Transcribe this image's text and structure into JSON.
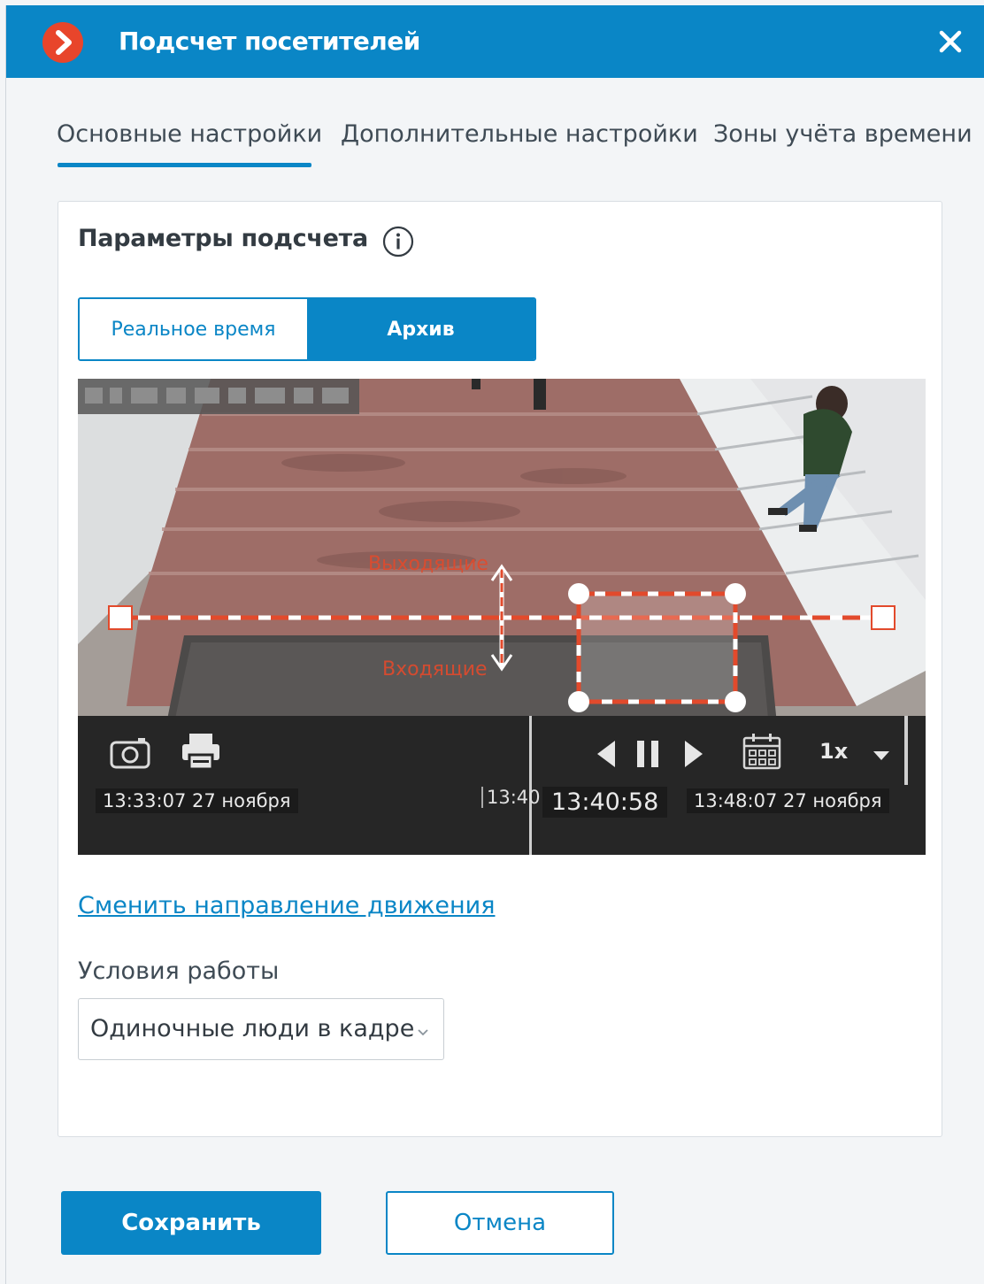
{
  "window": {
    "title": "Подсчет посетителей",
    "accent_color": "#0a86c6",
    "logo_color": "#e8452b"
  },
  "tabs": [
    {
      "label": "Основные настройки",
      "active": true
    },
    {
      "label": "Дополнительные настройки",
      "active": false
    },
    {
      "label": "Зоны учёта времени",
      "active": false
    }
  ],
  "section": {
    "title": "Параметры подсчета",
    "info_icon": "info-icon"
  },
  "mode_switch": {
    "realtime_label": "Реальное время",
    "archive_label": "Архив",
    "selected": "Архив"
  },
  "video": {
    "overlay_out_label": "Выходящие",
    "overlay_in_label": "Входящие",
    "speed": "1x",
    "range_start": "13:33:07 27 ноября",
    "mark_label": "13:40",
    "current_time": "13:40:58",
    "range_end": "13:48:07 27 ноября",
    "icons": [
      "camera-snapshot-icon",
      "print-icon",
      "step-back-icon",
      "pause-icon",
      "step-forward-icon",
      "calendar-icon",
      "chevron-down-icon"
    ]
  },
  "links": {
    "change_direction": "Сменить направление движения"
  },
  "conditions": {
    "label": "Условия работы",
    "value": "Одиночные люди в кадре"
  },
  "footer": {
    "save_label": "Сохранить",
    "cancel_label": "Отмена"
  }
}
